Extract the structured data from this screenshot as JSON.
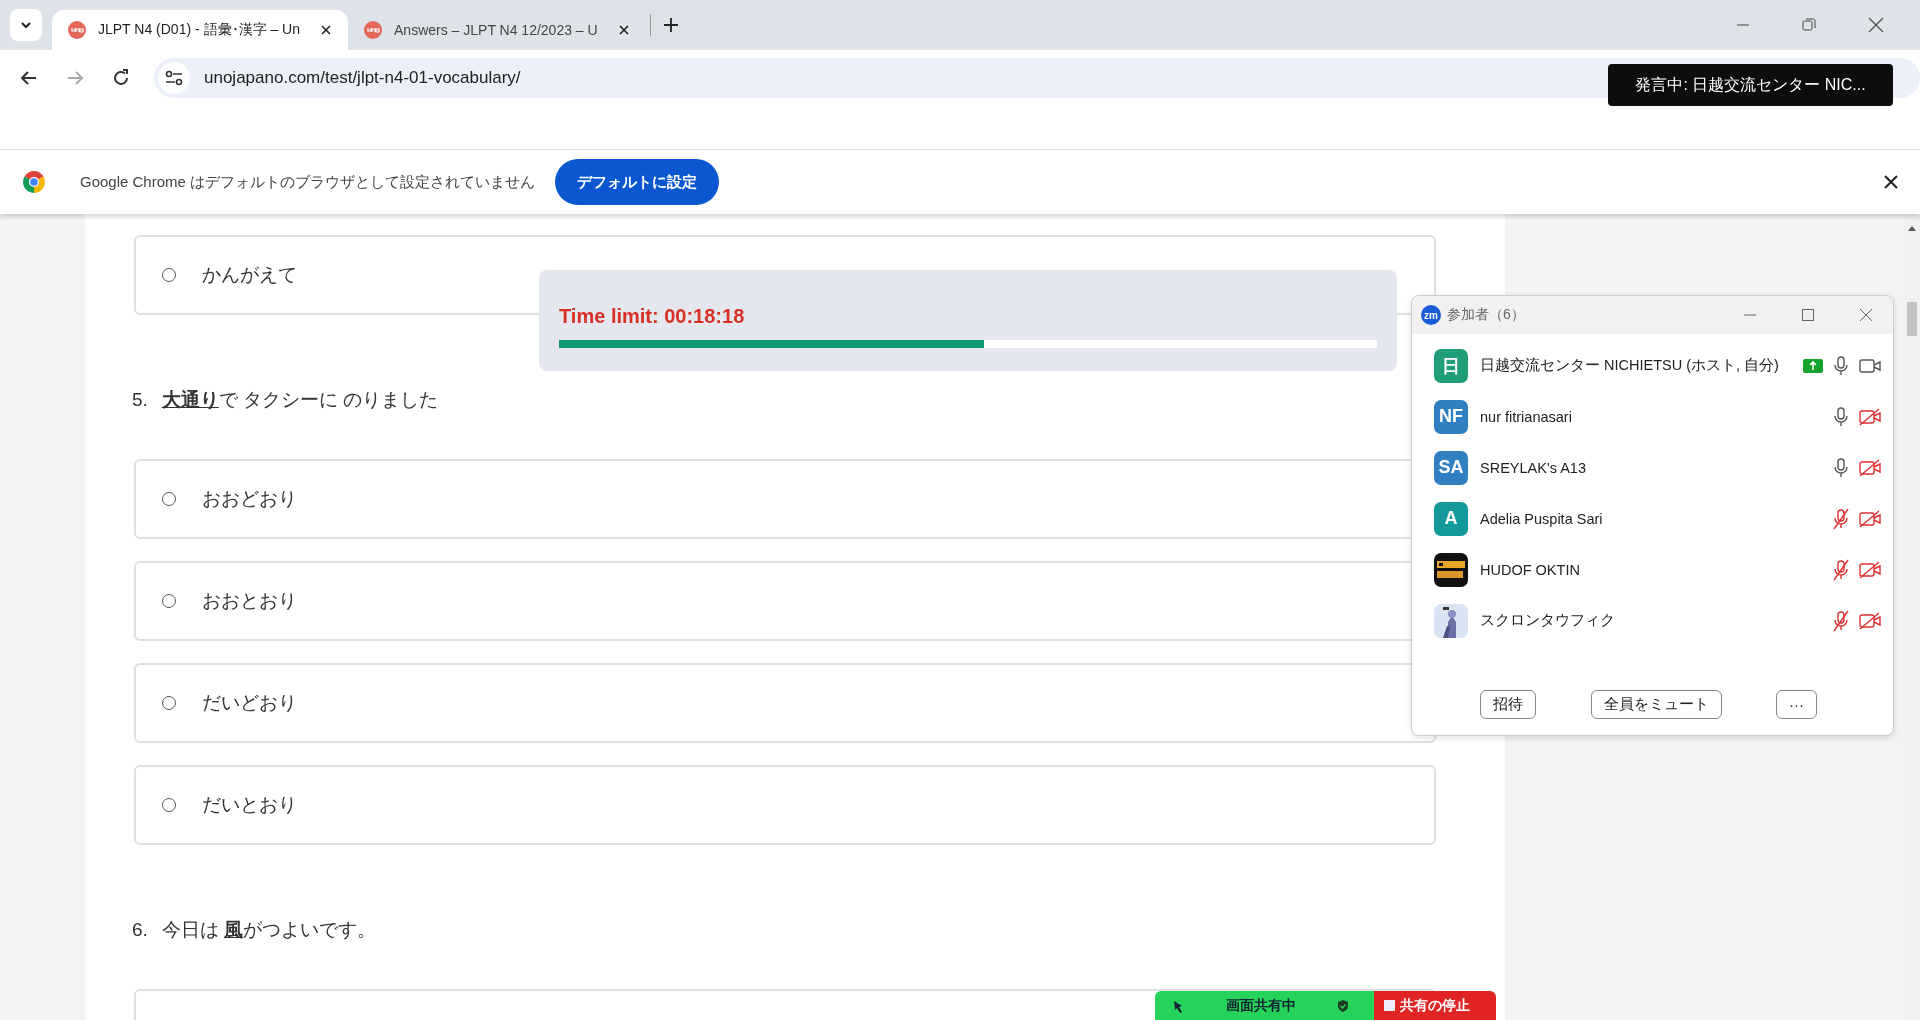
{
  "browser": {
    "tabs": [
      {
        "title": "JLPT N4 (D01) - 語彙･漢字 – Un",
        "selected": true
      },
      {
        "title": "Answers – JLPT N4 12/2023 – U",
        "selected": false
      }
    ],
    "address": "unojapano.com/test/jlpt-n4-01-vocabulary/"
  },
  "speaking_tooltip": "発言中: 日越交流センター NIC...",
  "default_banner": {
    "message": "Google Chrome はデフォルトのブラウザとして設定されていません",
    "button": "デフォルトに設定"
  },
  "quiz": [
    {
      "kind": "option",
      "text": "かんがえて",
      "selected": false
    },
    {
      "kind": "question",
      "number": "5.",
      "text": "**大通り**で タクシーに のりました"
    },
    {
      "kind": "option",
      "text": "おおどおり",
      "selected": false
    },
    {
      "kind": "option",
      "text": "おおとおり",
      "selected": false
    },
    {
      "kind": "option",
      "text": "だいどおり",
      "selected": false
    },
    {
      "kind": "option",
      "text": "だいとおり",
      "selected": false
    },
    {
      "kind": "question",
      "number": "6.",
      "text": "今日は **風**がつよいです。"
    },
    {
      "kind": "option"
    }
  ],
  "timer": {
    "label": "Time limit: 00:18:18",
    "level": 0.52
  },
  "participants_panel": {
    "badge": "zm",
    "title": "参加者（6）",
    "participants": [
      {
        "name": "日越交流センター NICHIETSU (ホスト, 自分)",
        "initials": "日",
        "color": "#1f9e78",
        "sharing": true,
        "muted": false,
        "camera_off": false
      },
      {
        "name": "nur fitrianasari",
        "initials": "NF",
        "color": "#2f7fc1",
        "sharing": false,
        "muted": false,
        "camera_off": true
      },
      {
        "name": "SREYLAK's A13",
        "initials": "SA",
        "color": "#2f7fc1",
        "sharing": false,
        "muted": false,
        "camera_off": true
      },
      {
        "name": "Adelia Puspita Sari",
        "initials": "A",
        "color": "#14999a",
        "sharing": false,
        "muted": true,
        "camera_off": true
      },
      {
        "name": "HUDOF OKTIN",
        "sharing": false,
        "muted": true,
        "camera_off": true
      },
      {
        "name": "スクロンタウフィク",
        "sharing": false,
        "muted": true,
        "camera_off": true
      }
    ],
    "buttons": [
      "招待",
      "全員をミュート",
      "···"
    ]
  },
  "share_bar": {
    "status": "画面共有中",
    "stop": "共有の停止"
  }
}
